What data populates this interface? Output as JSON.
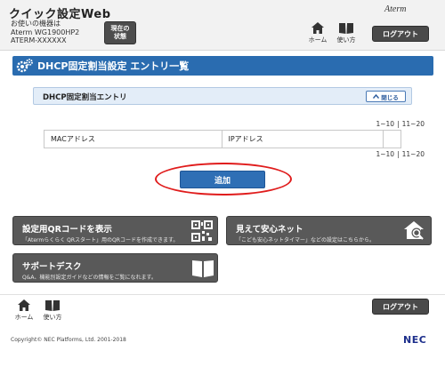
{
  "header": {
    "app_title": "クイック設定Web",
    "device_label": "お使いの機器は",
    "device_model": "Aterm WG1900HP2",
    "device_id": "ATERM-XXXXXX",
    "status_button": "現在の\n状態",
    "brand": "Aterm",
    "nav_home": "ホーム",
    "nav_manual": "使い方",
    "logout": "ログアウト"
  },
  "page": {
    "title": "DHCP固定割当設定 エントリ一覧"
  },
  "section": {
    "title": "DHCP固定割当エントリ",
    "collapse_label": "閉じる"
  },
  "pager": {
    "range1": "1~10",
    "range2": "11~20"
  },
  "table": {
    "col_mac": "MACアドレス",
    "col_ip": "IPアドレス"
  },
  "add_button": "追加",
  "tiles": {
    "qr": {
      "title": "設定用QRコードを表示",
      "desc": "「Atermらくらく QRスタート」用のQRコードを作成できます。"
    },
    "net": {
      "title": "見えて安心ネット",
      "desc": "「こども安心ネットタイマー」などの設定はこちらから。"
    },
    "support": {
      "title": "サポートデスク",
      "desc": "Q&A、機能別設定ガイドなどの情報をご覧になれます。"
    }
  },
  "footer": {
    "nav_home": "ホーム",
    "nav_manual": "使い方",
    "logout": "ログアウト",
    "copyright": "Copyright© NEC Platforms, Ltd. 2001-2018",
    "nec": "NEC"
  },
  "colors": {
    "accent_blue": "#2a6cb0",
    "highlight_red": "#e01c1c",
    "tile_gray": "#595959"
  }
}
